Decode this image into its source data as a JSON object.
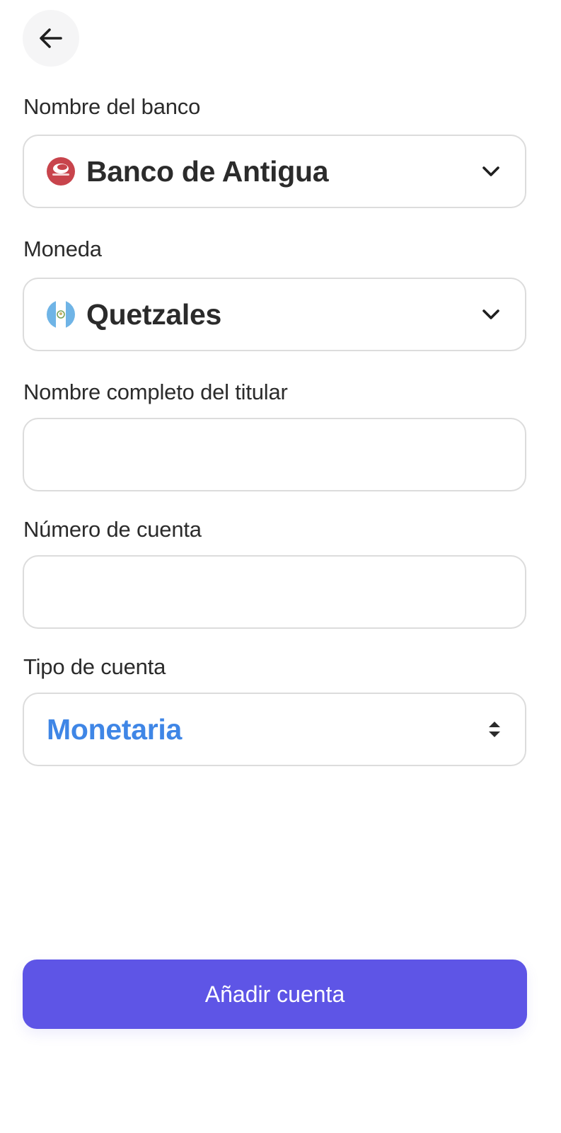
{
  "header": {
    "back_icon": "arrow-left-icon"
  },
  "form": {
    "bank": {
      "label": "Nombre del banco",
      "value": "Banco de Antigua",
      "icon": "bank-logo-icon",
      "logo_color": "#c8444c"
    },
    "currency": {
      "label": "Moneda",
      "value": "Quetzales",
      "icon": "guatemala-flag-icon"
    },
    "holder_name": {
      "label": "Nombre completo del titular",
      "value": ""
    },
    "account_number": {
      "label": "Número de cuenta",
      "value": ""
    },
    "account_type": {
      "label": "Tipo de cuenta",
      "value": "Monetaria",
      "value_color": "#3f86e6"
    }
  },
  "actions": {
    "add_account_label": "Añadir cuenta",
    "button_color": "#5e55e6"
  }
}
